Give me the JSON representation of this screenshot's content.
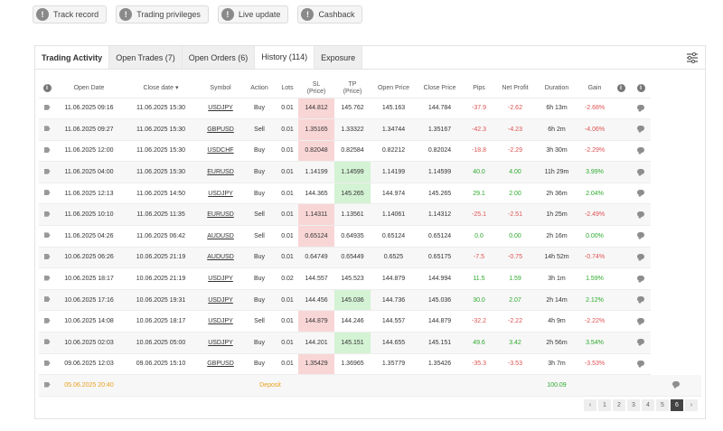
{
  "top_buttons": [
    {
      "label": "Track record"
    },
    {
      "label": "Trading privileges"
    },
    {
      "label": "Live update"
    },
    {
      "label": "Cashback"
    }
  ],
  "tabs": [
    {
      "label": "Trading Activity"
    },
    {
      "label": "Open Trades (7)"
    },
    {
      "label": "Open Orders (6)"
    },
    {
      "label": "History (114)"
    },
    {
      "label": "Exposure"
    }
  ],
  "columns": {
    "open_date": "Open Date",
    "close_date": "Close date ▾",
    "symbol": "Symbol",
    "action": "Action",
    "lots": "Lots",
    "sl_1": "SL",
    "sl_2": "(Price)",
    "tp_1": "TP",
    "tp_2": "(Price)",
    "open_price": "Open Price",
    "close_price": "Close Price",
    "pips": "Pips",
    "net_profit": "Net Profit",
    "duration": "Duration",
    "gain": "Gain"
  },
  "rows": [
    {
      "open_date": "11.06.2025 09:16",
      "close_date": "11.06.2025 15:30",
      "symbol": "USDJPY",
      "action": "Buy",
      "lots": "0.01",
      "sl": "144.812",
      "tp": "145.762",
      "open_price": "145.163",
      "close_price": "144.784",
      "pips": "-37.9",
      "net_profit": "-2.62",
      "duration": "6h 13m",
      "gain": "-2.68%"
    },
    {
      "open_date": "11.06.2025 09:27",
      "close_date": "11.06.2025 15:30",
      "symbol": "GBPUSD",
      "action": "Sell",
      "lots": "0.01",
      "sl": "1.35165",
      "tp": "1.33322",
      "open_price": "1.34744",
      "close_price": "1.35167",
      "pips": "-42.3",
      "net_profit": "-4.23",
      "duration": "6h 2m",
      "gain": "-4.06%"
    },
    {
      "open_date": "11.06.2025 12:00",
      "close_date": "11.06.2025 15:30",
      "symbol": "USDCHF",
      "action": "Buy",
      "lots": "0.01",
      "sl": "0.82048",
      "tp": "0.82584",
      "open_price": "0.82212",
      "close_price": "0.82024",
      "pips": "-18.8",
      "net_profit": "-2.29",
      "duration": "3h 30m",
      "gain": "-2.29%"
    },
    {
      "open_date": "11.06.2025 04:00",
      "close_date": "11.06.2025 15:30",
      "symbol": "EURUSD",
      "action": "Buy",
      "lots": "0.01",
      "sl": "1.14199",
      "tp": "1.14599",
      "open_price": "1.14199",
      "close_price": "1.14599",
      "pips": "40.0",
      "net_profit": "4.00",
      "duration": "11h 29m",
      "gain": "3.99%"
    },
    {
      "open_date": "11.06.2025 12:13",
      "close_date": "11.06.2025 14:50",
      "symbol": "USDJPY",
      "action": "Buy",
      "lots": "0.01",
      "sl": "144.365",
      "tp": "145.265",
      "open_price": "144.974",
      "close_price": "145.265",
      "pips": "29.1",
      "net_profit": "2.00",
      "duration": "2h 36m",
      "gain": "2.04%"
    },
    {
      "open_date": "11.06.2025 10:10",
      "close_date": "11.06.2025 11:35",
      "symbol": "EURUSD",
      "action": "Sell",
      "lots": "0.01",
      "sl": "1.14311",
      "tp": "1.13561",
      "open_price": "1.14061",
      "close_price": "1.14312",
      "pips": "-25.1",
      "net_profit": "-2.51",
      "duration": "1h 25m",
      "gain": "-2.49%"
    },
    {
      "open_date": "11.06.2025 04:26",
      "close_date": "11.06.2025 06:42",
      "symbol": "AUDUSD",
      "action": "Sell",
      "lots": "0.01",
      "sl": "0.65124",
      "tp": "0.64935",
      "open_price": "0.65124",
      "close_price": "0.65124",
      "pips": "0.0",
      "net_profit": "0.00",
      "duration": "2h 16m",
      "gain": "0.00%"
    },
    {
      "open_date": "10.06.2025 06:26",
      "close_date": "10.06.2025 21:19",
      "symbol": "AUDUSD",
      "action": "Buy",
      "lots": "0.01",
      "sl": "0.64749",
      "tp": "0.65449",
      "open_price": "0.6525",
      "close_price": "0.65175",
      "pips": "-7.5",
      "net_profit": "-0.75",
      "duration": "14h 52m",
      "gain": "-0.74%"
    },
    {
      "open_date": "10.06.2025 18:17",
      "close_date": "10.06.2025 21:19",
      "symbol": "USDJPY",
      "action": "Buy",
      "lots": "0.02",
      "sl": "144.557",
      "tp": "145.523",
      "open_price": "144.879",
      "close_price": "144.994",
      "pips": "11.5",
      "net_profit": "1.59",
      "duration": "3h 1m",
      "gain": "1.59%"
    },
    {
      "open_date": "10.06.2025 17:16",
      "close_date": "10.06.2025 19:31",
      "symbol": "USDJPY",
      "action": "Buy",
      "lots": "0.01",
      "sl": "144.456",
      "tp": "145.036",
      "open_price": "144.736",
      "close_price": "145.036",
      "pips": "30.0",
      "net_profit": "2.07",
      "duration": "2h 14m",
      "gain": "2.12%"
    },
    {
      "open_date": "10.06.2025 14:08",
      "close_date": "10.06.2025 18:17",
      "symbol": "USDJPY",
      "action": "Sell",
      "lots": "0.01",
      "sl": "144.879",
      "tp": "144.246",
      "open_price": "144.557",
      "close_price": "144.879",
      "pips": "-32.2",
      "net_profit": "-2.22",
      "duration": "4h 9m",
      "gain": "-2.22%"
    },
    {
      "open_date": "10.06.2025 02:03",
      "close_date": "10.06.2025 05:00",
      "symbol": "USDJPY",
      "action": "Buy",
      "lots": "0.01",
      "sl": "144.201",
      "tp": "145.151",
      "open_price": "144.655",
      "close_price": "145.151",
      "pips": "49.6",
      "net_profit": "3.42",
      "duration": "2h 56m",
      "gain": "3.54%"
    },
    {
      "open_date": "09.06.2025 12:03",
      "close_date": "09.06.2025 15:10",
      "symbol": "GBPUSD",
      "action": "Buy",
      "lots": "0.01",
      "sl": "1.35429",
      "tp": "1.36965",
      "open_price": "1.35779",
      "close_price": "1.35426",
      "pips": "-35.3",
      "net_profit": "-3.53",
      "duration": "3h 7m",
      "gain": "-3.53%"
    }
  ],
  "deposit_row": {
    "open_date": "05.06.2025 20:40",
    "label": "Deposit",
    "net_profit": "100.09"
  },
  "pagination": {
    "pages": [
      "1",
      "2",
      "3",
      "4",
      "5",
      "6"
    ],
    "current": "6",
    "prev": "‹",
    "next": "›"
  },
  "colors": {
    "negative": "#e05252",
    "positive": "#2eaa2e",
    "sl_bg": "#f9d6d6",
    "tp_bg": "#d4f2d4",
    "deposit": "#e8a21e"
  }
}
